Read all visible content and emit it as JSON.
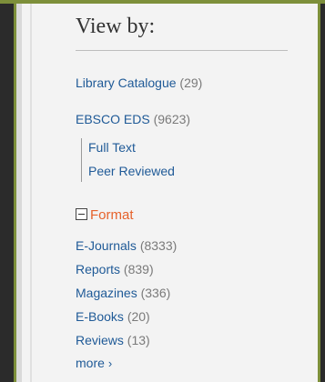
{
  "view_by": {
    "heading": "View by:",
    "sources": [
      {
        "label": "Library Catalogue",
        "count": "(29)"
      },
      {
        "label": "EBSCO EDS",
        "count": "(9623)"
      }
    ],
    "sub_options": [
      "Full Text",
      "Peer Reviewed"
    ]
  },
  "format": {
    "title": "Format",
    "items": [
      {
        "label": "E-Journals",
        "count": "(8333)"
      },
      {
        "label": "Reports",
        "count": "(839)"
      },
      {
        "label": "Magazines",
        "count": "(336)"
      },
      {
        "label": "E-Books",
        "count": "(20)"
      },
      {
        "label": "Reviews",
        "count": "(13)"
      }
    ],
    "more_label": "more",
    "more_icon": "chevron-right-icon"
  },
  "colors": {
    "link": "#1f5a97",
    "accent": "#e6622b",
    "frame": "#7d8f3a"
  }
}
